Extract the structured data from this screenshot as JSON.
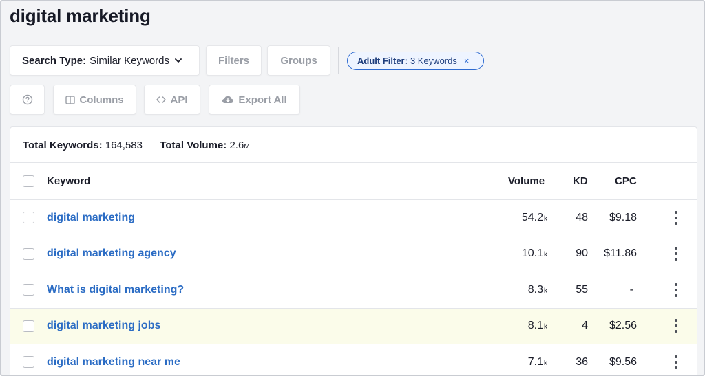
{
  "page": {
    "title": "digital marketing"
  },
  "toolbar": {
    "search_type_label": "Search Type:",
    "search_type_value": "Similar Keywords",
    "filters_label": "Filters",
    "groups_label": "Groups",
    "adult_filter_label": "Adult Filter:",
    "adult_filter_value": "3 Keywords",
    "adult_filter_remove": "×",
    "columns_label": "Columns",
    "api_label": "API",
    "export_label": "Export All"
  },
  "summary": {
    "total_keywords_label": "Total Keywords:",
    "total_keywords_value": "164,583",
    "total_volume_label": "Total Volume:",
    "total_volume_value": "2.6",
    "total_volume_unit": "M"
  },
  "table": {
    "columns": {
      "keyword": "Keyword",
      "volume": "Volume",
      "kd": "KD",
      "cpc": "CPC"
    },
    "rows": [
      {
        "keyword": "digital marketing",
        "volume": "54.2",
        "volume_unit": "k",
        "kd": "48",
        "cpc": "$9.18",
        "highlighted": false
      },
      {
        "keyword": "digital marketing agency",
        "volume": "10.1",
        "volume_unit": "k",
        "kd": "90",
        "cpc": "$11.86",
        "highlighted": false
      },
      {
        "keyword": "What is digital marketing?",
        "volume": "8.3",
        "volume_unit": "k",
        "kd": "55",
        "cpc": "-",
        "highlighted": false
      },
      {
        "keyword": "digital marketing jobs",
        "volume": "8.1",
        "volume_unit": "k",
        "kd": "4",
        "cpc": "$2.56",
        "highlighted": true
      },
      {
        "keyword": "digital marketing near me",
        "volume": "7.1",
        "volume_unit": "k",
        "kd": "36",
        "cpc": "$9.56",
        "highlighted": false
      }
    ]
  },
  "icons": {
    "chevron": "chevron-down-icon",
    "help": "question-circle-icon",
    "columns": "columns-icon",
    "api": "code-brackets-icon",
    "export": "cloud-download-icon",
    "row_menu": "more-vertical-icon"
  },
  "colors": {
    "link": "#2b6cc4",
    "chip_border": "#2e6bd1",
    "chip_bg": "#eef4ff",
    "highlight_row": "#fbfcea"
  }
}
